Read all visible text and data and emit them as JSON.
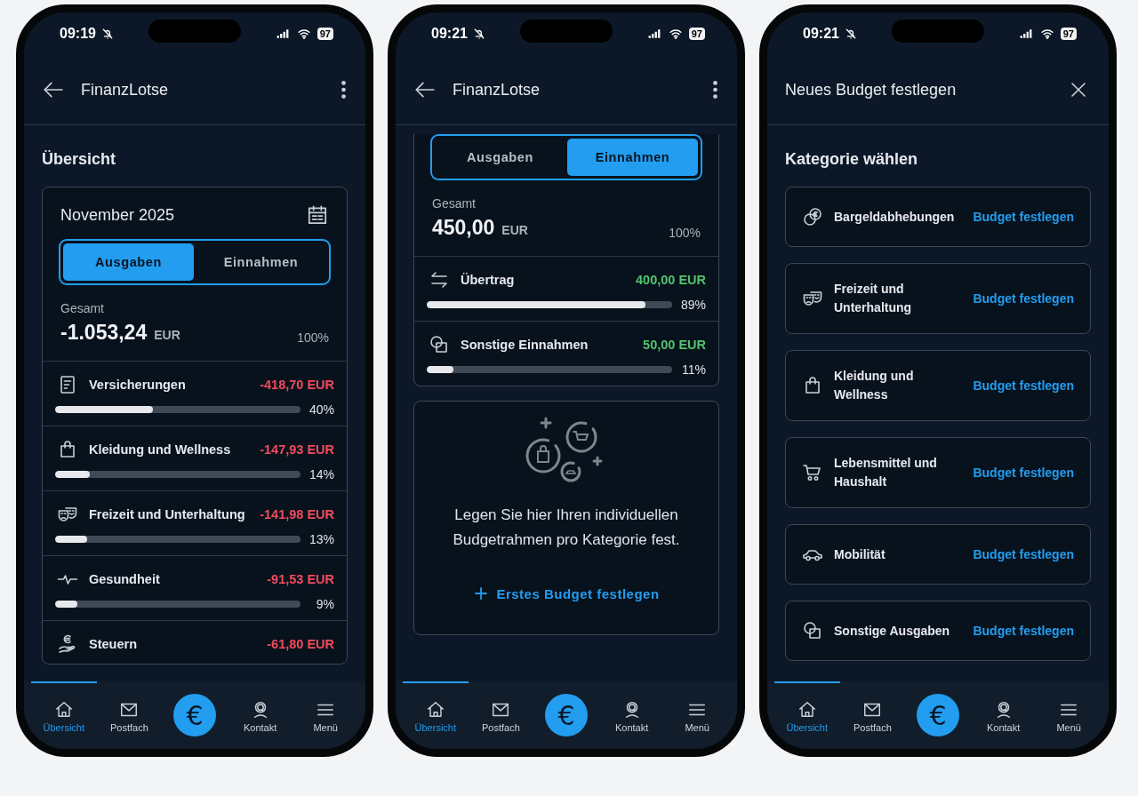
{
  "phones": [
    {
      "status": {
        "time": "09:19",
        "battery": "97"
      },
      "header": {
        "kind": "back",
        "title": "FinanzLotse"
      },
      "section_title": "Übersicht",
      "summary": {
        "month": "November 2025",
        "toggle": [
          {
            "label": "Ausgaben",
            "selected": true
          },
          {
            "label": "Einnahmen",
            "selected": false
          }
        ],
        "total_label": "Gesamt",
        "total": "-1.053,24",
        "currency": "EUR",
        "share": "100%",
        "categories": [
          {
            "kind": "document",
            "name": "Versicherungen",
            "amount": "-418,70 EUR",
            "color": "#f24b5c",
            "level": 0.4,
            "percent": "40%"
          },
          {
            "kind": "bag",
            "name": "Kleidung und Wellness",
            "amount": "-147,93 EUR",
            "color": "#f24b5c",
            "level": 0.14,
            "percent": "14%"
          },
          {
            "kind": "masks",
            "name": "Freizeit und Unterhaltung",
            "amount": "-141,98 EUR",
            "color": "#f24b5c",
            "level": 0.13,
            "percent": "13%"
          },
          {
            "kind": "pulse",
            "name": "Gesundheit",
            "amount": "-91,53 EUR",
            "color": "#f24b5c",
            "level": 0.09,
            "percent": "9%"
          },
          {
            "kind": "tax",
            "name": "Steuern",
            "amount": "-61,80 EUR",
            "color": "#f24b5c"
          }
        ]
      },
      "nav": [
        {
          "kind": "home",
          "label": "Übersicht",
          "selected": true
        },
        {
          "kind": "mail",
          "label": "Postfach",
          "selected": false
        },
        {
          "kind": "fab",
          "symbol": "€"
        },
        {
          "kind": "contact",
          "label": "Kontakt",
          "selected": false
        },
        {
          "kind": "menu",
          "label": "Menü",
          "selected": false
        }
      ]
    },
    {
      "status": {
        "time": "09:21",
        "battery": "97"
      },
      "header": {
        "kind": "back",
        "title": "FinanzLotse"
      },
      "summary": {
        "toggle": [
          {
            "label": "Ausgaben",
            "selected": false
          },
          {
            "label": "Einnahmen",
            "selected": true
          }
        ],
        "total_label": "Gesamt",
        "total": "450,00",
        "currency": "EUR",
        "share": "100%",
        "categories": [
          {
            "kind": "transfer",
            "name": "Übertrag",
            "amount": "400,00 EUR",
            "color": "#52c46d",
            "level": 0.89,
            "percent": "89%"
          },
          {
            "kind": "shapes",
            "name": "Sonstige Einnahmen",
            "amount": "50,00 EUR",
            "color": "#52c46d",
            "level": 0.11,
            "percent": "11%"
          }
        ]
      },
      "empty_state": {
        "text": "Legen Sie hier Ihren individuellen Budgetrahmen pro Kategorie fest.",
        "action": "Erstes Budget festlegen"
      },
      "nav": [
        {
          "kind": "home",
          "label": "Übersicht",
          "selected": true
        },
        {
          "kind": "mail",
          "label": "Postfach",
          "selected": false
        },
        {
          "kind": "fab",
          "symbol": "€"
        },
        {
          "kind": "contact",
          "label": "Kontakt",
          "selected": false
        },
        {
          "kind": "menu",
          "label": "Menü",
          "selected": false
        }
      ]
    },
    {
      "status": {
        "time": "09:21",
        "battery": "97"
      },
      "header": {
        "kind": "close",
        "title": "Neues Budget festlegen"
      },
      "section_title": "Kategorie wählen",
      "budget_categories": [
        {
          "kind": "coins",
          "name": "Bargeldabhebungen",
          "action": "Budget festlegen"
        },
        {
          "kind": "masks",
          "name": "Freizeit und Unterhaltung",
          "action": "Budget festlegen"
        },
        {
          "kind": "bag",
          "name": "Kleidung und Wellness",
          "action": "Budget festlegen"
        },
        {
          "kind": "cart",
          "name": "Lebensmittel und Haushalt",
          "action": "Budget festlegen"
        },
        {
          "kind": "car",
          "name": "Mobilität",
          "action": "Budget festlegen"
        },
        {
          "kind": "shapes",
          "name": "Sonstige Ausgaben",
          "action": "Budget festlegen"
        }
      ],
      "nav": [
        {
          "kind": "home",
          "label": "Übersicht",
          "selected": true
        },
        {
          "kind": "mail",
          "label": "Postfach",
          "selected": false
        },
        {
          "kind": "fab",
          "symbol": "€"
        },
        {
          "kind": "contact",
          "label": "Kontakt",
          "selected": false
        },
        {
          "kind": "menu",
          "label": "Menü",
          "selected": false
        }
      ]
    }
  ]
}
